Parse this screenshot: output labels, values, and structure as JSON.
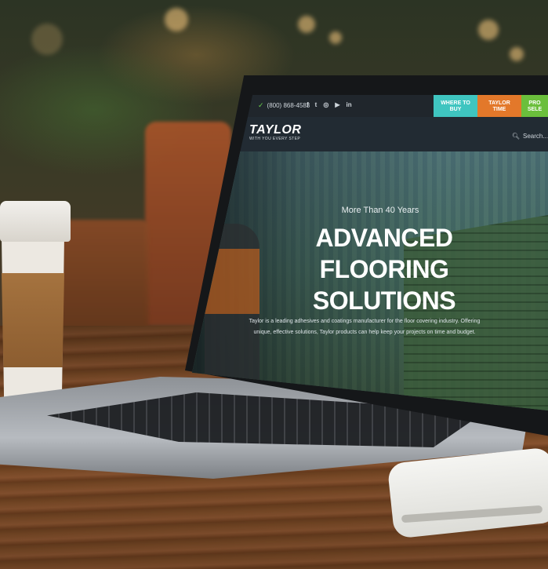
{
  "site": {
    "topbar": {
      "phone": "(800) 868-4583",
      "social_icons": [
        "facebook-icon",
        "twitter-icon",
        "instagram-icon",
        "youtube-icon",
        "linkedin-icon"
      ],
      "social_glyphs": [
        "f",
        "t",
        "◎",
        "▶",
        "in"
      ]
    },
    "tabs": [
      {
        "label": "WHERE TO BUY",
        "color": "#3fc5c0"
      },
      {
        "label": "TAYLOR TIME",
        "color": "#e3782a"
      },
      {
        "label": "PRO SELE",
        "color": "#6bbf3c"
      }
    ],
    "logo": {
      "name": "TAYLOR",
      "tagline": "WITH YOU EVERY STEP"
    },
    "search": {
      "placeholder": "Search..."
    },
    "hero": {
      "eyebrow": "More Than 40 Years",
      "headline_line1": "ADVANCED",
      "headline_line2": "FLOORING",
      "headline_line3": "SOLUTIONS",
      "description": "Taylor is a leading adhesives and coatings manufacturer for the floor covering industry. Offering unique, effective solutions, Taylor products can help keep your projects on time and budget."
    }
  }
}
